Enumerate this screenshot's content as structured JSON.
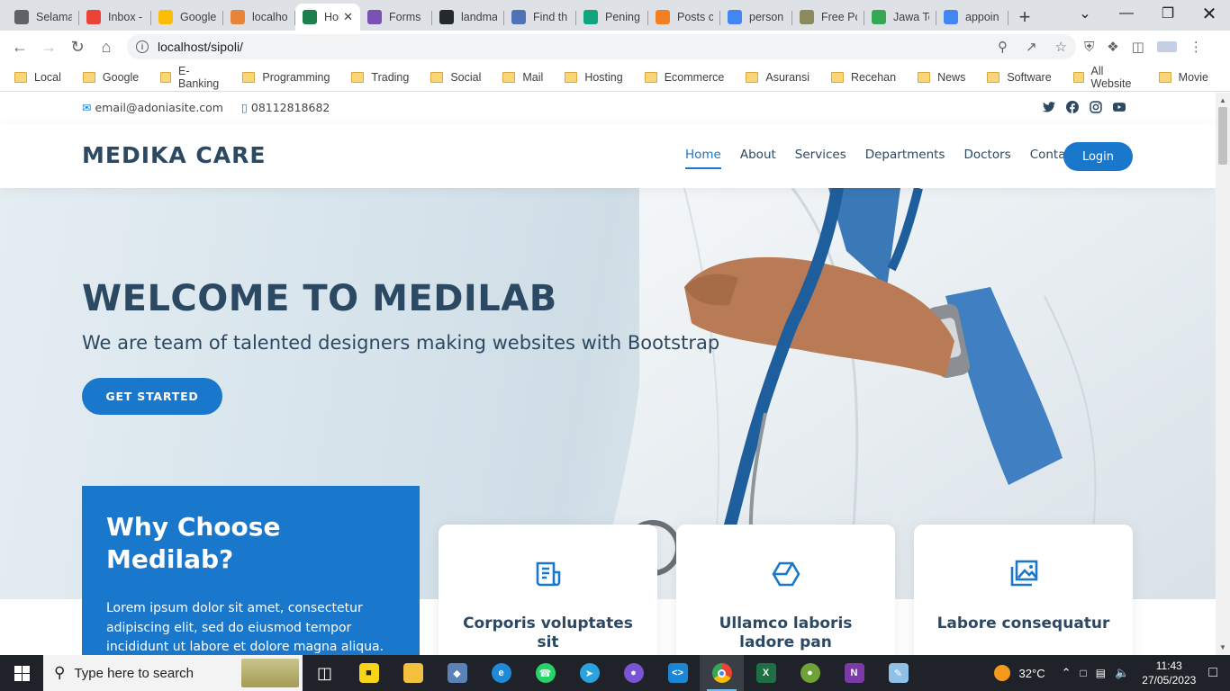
{
  "browser": {
    "tabs": [
      {
        "title": "Selamat",
        "icon": "globe-icon",
        "color": "#5f6368"
      },
      {
        "title": "Inbox -",
        "icon": "gmail-icon",
        "color": "#ea4335"
      },
      {
        "title": "Google",
        "icon": "google-ads-icon",
        "color": "#fbbc04"
      },
      {
        "title": "localhost",
        "icon": "phpmyadmin-icon",
        "color": "#e8833a"
      },
      {
        "title": "Home",
        "icon": "gear-icon",
        "color": "#1e7f4e",
        "active": true
      },
      {
        "title": "Forms",
        "icon": "bootstrap-icon",
        "color": "#7952b3"
      },
      {
        "title": "landmark",
        "icon": "github-icon",
        "color": "#24292f"
      },
      {
        "title": "Find th",
        "icon": "flag-icon",
        "color": "#4f73b5"
      },
      {
        "title": "Pening",
        "icon": "openai-icon",
        "color": "#10a37f"
      },
      {
        "title": "Posts c",
        "icon": "stackoverflow-icon",
        "color": "#f48024"
      },
      {
        "title": "person",
        "icon": "google-icon",
        "color": "#4285f4"
      },
      {
        "title": "Free Pc",
        "icon": "image-icon",
        "color": "#8a8a5c"
      },
      {
        "title": "Jawa Te",
        "icon": "maps-icon",
        "color": "#34a853"
      },
      {
        "title": "appoin",
        "icon": "google-icon",
        "color": "#4285f4"
      }
    ],
    "url": "localhost/sipoli/",
    "bookmarks": [
      "Local",
      "Google",
      "E-Banking",
      "Programming",
      "Trading",
      "Social",
      "Mail",
      "Hosting",
      "Ecommerce",
      "Asuransi",
      "Recehan",
      "News",
      "Software",
      "All Website",
      "Movie"
    ]
  },
  "site": {
    "email": "email@adoniasite.com",
    "phone": "08112818682",
    "logo": "MEDIKA CARE",
    "nav": [
      "Home",
      "About",
      "Services",
      "Departments",
      "Doctors",
      "Contact"
    ],
    "login": "Login",
    "hero_title": "WELCOME TO MEDILAB",
    "hero_subtitle": "We are team of talented designers making websites with Bootstrap",
    "cta": "GET STARTED",
    "why_title": "Why Choose Medilab?",
    "why_text": "Lorem ipsum dolor sit amet, consectetur adipiscing elit, sed do eiusmod tempor incididunt ut labore et dolore magna aliqua.",
    "cards": [
      {
        "title": "Corporis voluptates sit",
        "icon": "receipt-icon"
      },
      {
        "title": "Ullamco laboris ladore pan",
        "icon": "cube-icon"
      },
      {
        "title": "Labore consequatur",
        "icon": "images-icon"
      }
    ],
    "accent": "#1977cc",
    "heading_color": "#2c4964"
  },
  "taskbar": {
    "search_placeholder": "Type here to search",
    "weather": "32°C",
    "time": "11:43",
    "date": "27/05/2023"
  }
}
